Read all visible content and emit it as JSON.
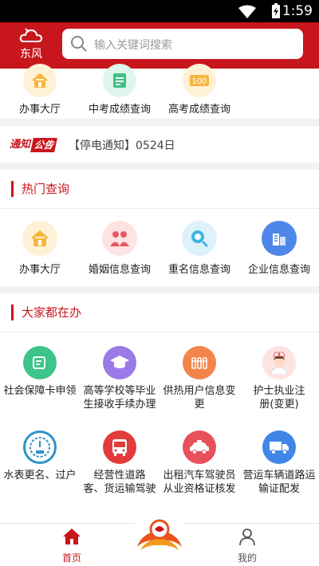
{
  "status": {
    "time": "1:59"
  },
  "header": {
    "city": "东风",
    "search_placeholder": "输入关键词搜索"
  },
  "top_items": [
    {
      "label": "办事大厅",
      "icon": "home-icon"
    },
    {
      "label": "中考成绩查询",
      "icon": "score-doc-icon"
    },
    {
      "label": "高考成绩查询",
      "icon": "score-100-icon"
    }
  ],
  "notice": {
    "badge1": "通知",
    "badge2": "公告",
    "text": "【停电通知】0524日"
  },
  "hot": {
    "title": "热门查询",
    "items": [
      {
        "label": "办事大厅",
        "icon": "home-icon"
      },
      {
        "label": "婚姻信息查询",
        "icon": "couple-icon"
      },
      {
        "label": "重名信息查询",
        "icon": "name-search-icon"
      },
      {
        "label": "企业信息查询",
        "icon": "building-icon"
      }
    ]
  },
  "handling": {
    "title": "大家都在办",
    "items": [
      {
        "line1": "社会保障卡申领",
        "line2": "",
        "icon": "card-icon"
      },
      {
        "line1": "高等学校等毕业",
        "line2": "生接收手续办理",
        "icon": "graduation-cap-icon"
      },
      {
        "line1": "供热用户信息变",
        "line2": "更",
        "icon": "radiator-icon"
      },
      {
        "line1": "护士执业注",
        "line2": "册(变更)",
        "icon": "nurse-icon"
      },
      {
        "line1": "水表更名、过户",
        "line2": "",
        "icon": "meter-icon"
      },
      {
        "line1": "经营性道路",
        "line2": "客、货运输驾驶",
        "icon": "bus-icon"
      },
      {
        "line1": "出租汽车驾驶员",
        "line2": "从业资格证核发",
        "icon": "taxi-icon"
      },
      {
        "line1": "营运车辆道路运",
        "line2": "输证配发",
        "icon": "truck-icon"
      }
    ]
  },
  "tabs": {
    "home": "首页",
    "me": "我的"
  },
  "colors": {
    "brand": "#c8161d"
  }
}
